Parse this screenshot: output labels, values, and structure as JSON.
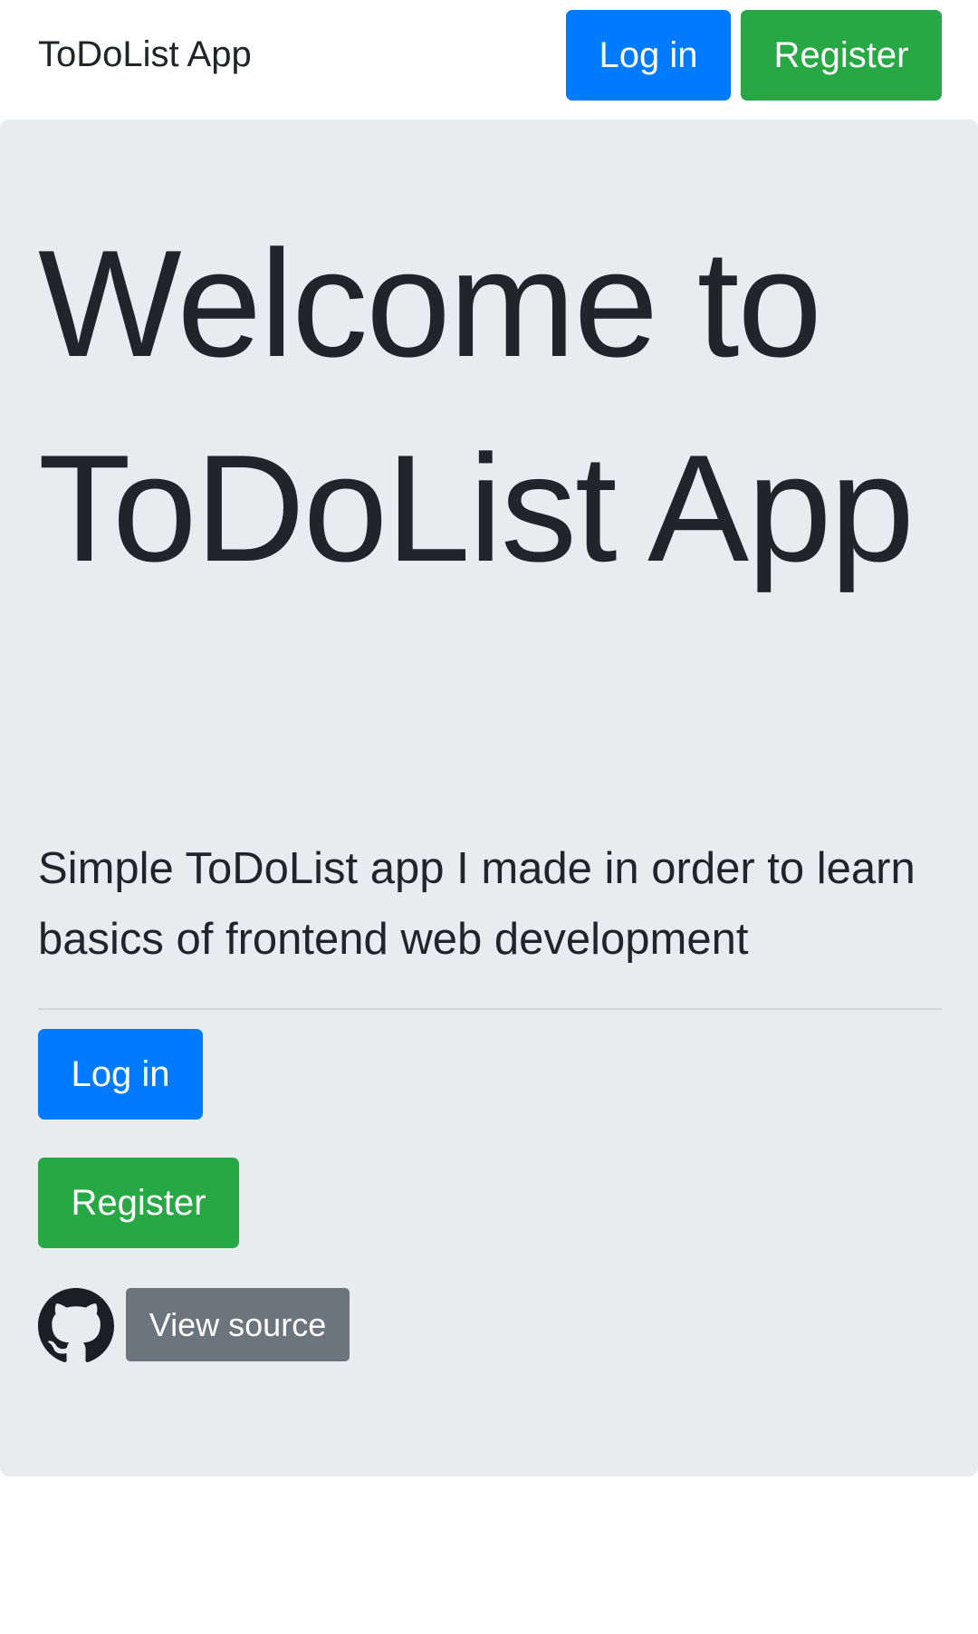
{
  "navbar": {
    "brand": "ToDoList App",
    "login_label": "Log in",
    "register_label": "Register"
  },
  "hero": {
    "title": "Welcome to ToDoList App",
    "lead": "Simple ToDoList app I made in order to learn basics of frontend web development",
    "login_label": "Log in",
    "register_label": "Register",
    "source_label": "View source"
  },
  "icons": {
    "source": "github-icon"
  },
  "colors": {
    "primary": "#007bff",
    "success": "#28a745",
    "secondary": "#6c757d",
    "jumbotron_bg": "#e9ecef",
    "text": "#212529"
  }
}
